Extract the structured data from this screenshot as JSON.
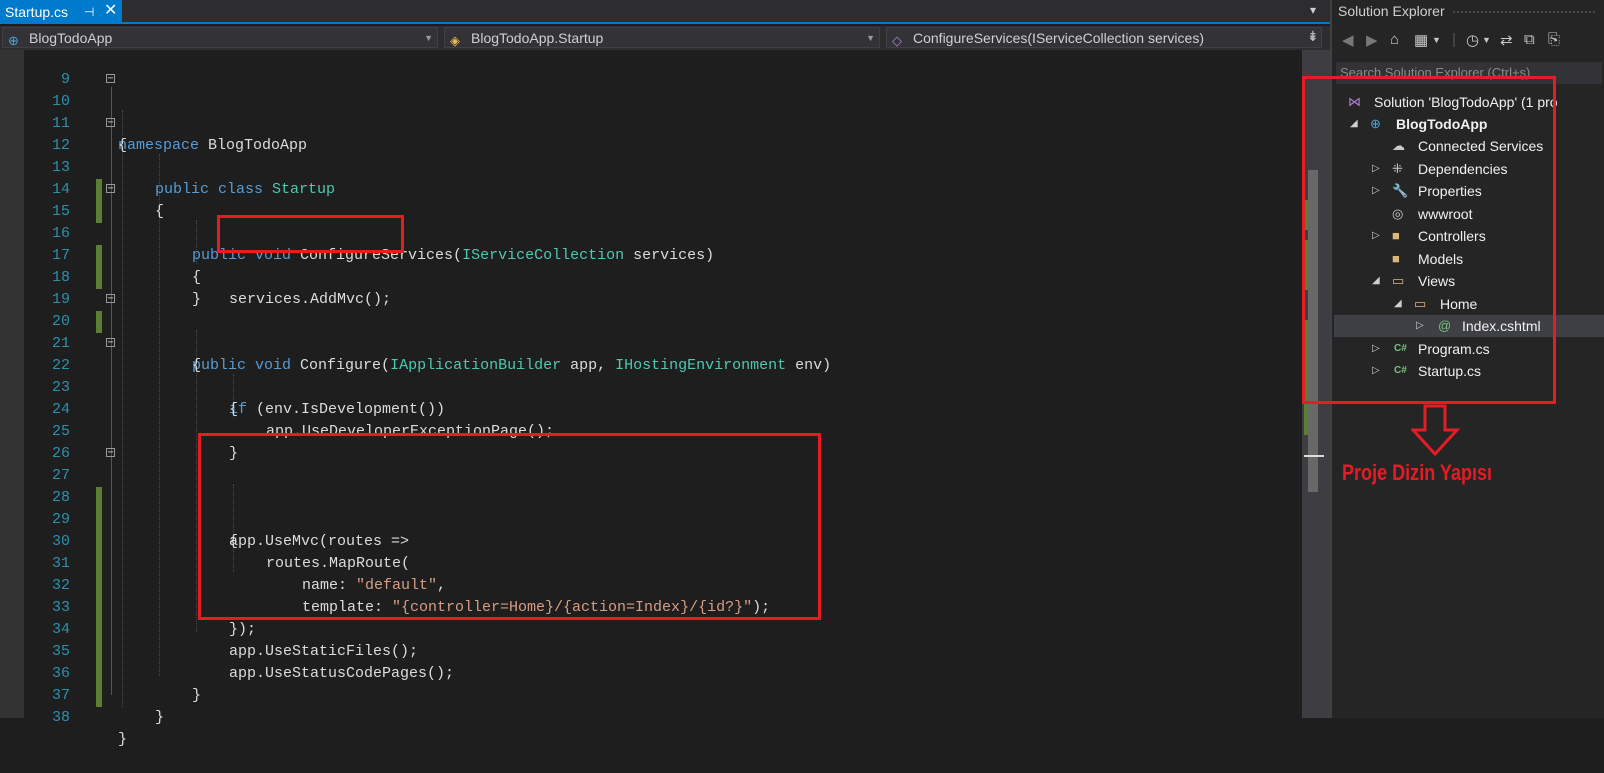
{
  "tab": {
    "title": "Startup.cs",
    "pin": "⊣",
    "close": "✕",
    "dropdown": "▾"
  },
  "nav": {
    "project": "BlogTodoApp",
    "class": "BlogTodoApp.Startup",
    "member": "ConfigureServices(IServiceCollection services)"
  },
  "editor": {
    "lines": [
      {
        "num": "9"
      },
      {
        "num": "10"
      },
      {
        "num": "11"
      },
      {
        "num": "12"
      },
      {
        "num": "13"
      },
      {
        "num": "14"
      },
      {
        "num": "15"
      },
      {
        "num": "16"
      },
      {
        "num": "17"
      },
      {
        "num": "18"
      },
      {
        "num": "19"
      },
      {
        "num": "20"
      },
      {
        "num": "21"
      },
      {
        "num": "22"
      },
      {
        "num": "23"
      },
      {
        "num": "24"
      },
      {
        "num": "25"
      },
      {
        "num": "26"
      },
      {
        "num": "27"
      },
      {
        "num": "28"
      },
      {
        "num": "29"
      },
      {
        "num": "30"
      },
      {
        "num": "31"
      },
      {
        "num": "32"
      },
      {
        "num": "33"
      },
      {
        "num": "34"
      },
      {
        "num": "35"
      },
      {
        "num": "36"
      },
      {
        "num": "37"
      },
      {
        "num": "38"
      }
    ],
    "tokens": {
      "l10_kw": "namespace",
      "l10_name": " BlogTodoApp",
      "l11": "{",
      "l12_kw": "public class",
      "l12_ty": " Startup",
      "l13": "{",
      "l15_kw": "public void",
      "l15_m": " ConfigureServices(",
      "l15_ty": "IServiceCollection",
      "l15_end": " services)",
      "l16": "{",
      "l17": "services.AddMvc();",
      "l18": "}",
      "l20_kw": "public void",
      "l20_m": " Configure(",
      "l20_ty1": "IApplicationBuilder",
      "l20_mid": " app, ",
      "l20_ty2": "IHostingEnvironment",
      "l20_end": " env)",
      "l21": "{",
      "l22_kw": "if",
      "l22_rest": " (env.IsDevelopment())",
      "l23": "{",
      "l24": "app.UseDeveloperExceptionPage();",
      "l25": "}",
      "l27": "app.UseMvc(routes =>",
      "l28": "{",
      "l29": "routes.MapRoute(",
      "l30_a": "name: ",
      "l30_s": "\"default\"",
      "l30_b": ",",
      "l31_a": "template: ",
      "l31_s": "\"{controller=Home}/{action=Index}/{id?}\"",
      "l31_b": ");",
      "l32": "});",
      "l33": "app.UseStaticFiles();",
      "l34": "app.UseStatusCodePages();",
      "l35": "}",
      "l37": "}",
      "l38": "}"
    }
  },
  "solution_explorer": {
    "title": "Solution Explorer",
    "search_placeholder": "Search Solution Explorer (Ctrl+ş)",
    "items": [
      {
        "label": "Solution 'BlogTodoApp' (1 pro",
        "icon": "solution-icon"
      },
      {
        "label": "BlogTodoApp",
        "icon": "web-project-icon"
      },
      {
        "label": "Connected Services",
        "icon": "cloud-icon"
      },
      {
        "label": "Dependencies",
        "icon": "dependencies-icon"
      },
      {
        "label": "Properties",
        "icon": "wrench-icon"
      },
      {
        "label": "wwwroot",
        "icon": "globe-icon"
      },
      {
        "label": "Controllers",
        "icon": "folder-icon"
      },
      {
        "label": "Models",
        "icon": "folder-icon"
      },
      {
        "label": "Views",
        "icon": "folder-open-icon"
      },
      {
        "label": "Home",
        "icon": "folder-open-icon"
      },
      {
        "label": "Index.cshtml",
        "icon": "razor-file-icon"
      },
      {
        "label": "Program.cs",
        "icon": "csharp-file-icon"
      },
      {
        "label": "Startup.cs",
        "icon": "csharp-file-icon"
      }
    ]
  },
  "annotation": {
    "text": "Proje Dizin Yapısı",
    "color": "#e51c23"
  },
  "colors": {
    "accent": "#007acc",
    "keyword": "#569cd6",
    "type": "#4ec9b0",
    "string": "#d69d85",
    "line_number": "#2b91af"
  }
}
